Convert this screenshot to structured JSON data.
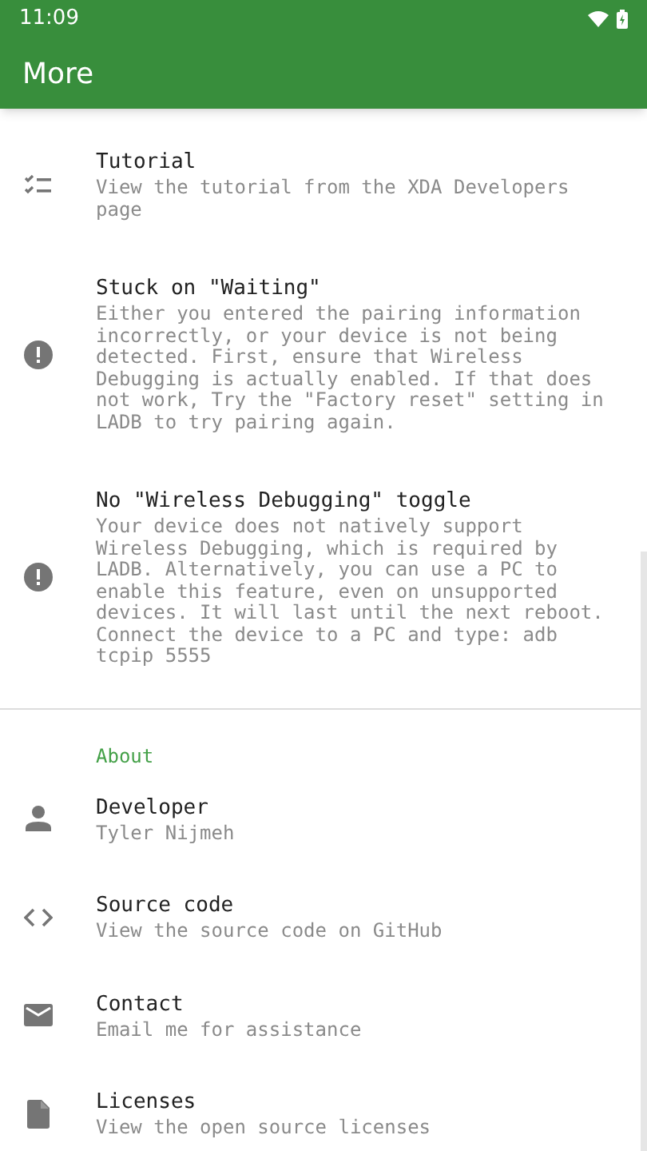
{
  "status_bar": {
    "time": "11:09"
  },
  "app_bar": {
    "title": "More"
  },
  "sections": [
    {
      "items": [
        {
          "kind": "checklist",
          "title": "Tutorial",
          "summary": "View the tutorial from the XDA Developers page"
        },
        {
          "kind": "alert",
          "title": "Stuck on \"Waiting\"",
          "summary": "Either you entered the pairing information incorrectly, or your device is not being detected. First, ensure that Wireless Debugging is actually enabled. If that does not work, Try the \"Factory reset\" setting in LADB to try pairing again."
        },
        {
          "kind": "alert",
          "title": "No \"Wireless Debugging\" toggle",
          "summary": "Your device does not natively support Wireless Debugging, which is required by LADB. Alternatively, you can use a PC to enable this feature, even on unsupported devices. It will last until the next reboot. Connect the device to a PC and type: adb tcpip 5555"
        }
      ]
    },
    {
      "header": "About",
      "items": [
        {
          "kind": "person",
          "title": "Developer",
          "summary": "Tyler Nijmeh"
        },
        {
          "kind": "code",
          "title": "Source code",
          "summary": "View the source code on GitHub"
        },
        {
          "kind": "mail",
          "title": "Contact",
          "summary": "Email me for assistance"
        },
        {
          "kind": "file",
          "title": "Licenses",
          "summary": "View the open source licenses"
        }
      ]
    }
  ]
}
